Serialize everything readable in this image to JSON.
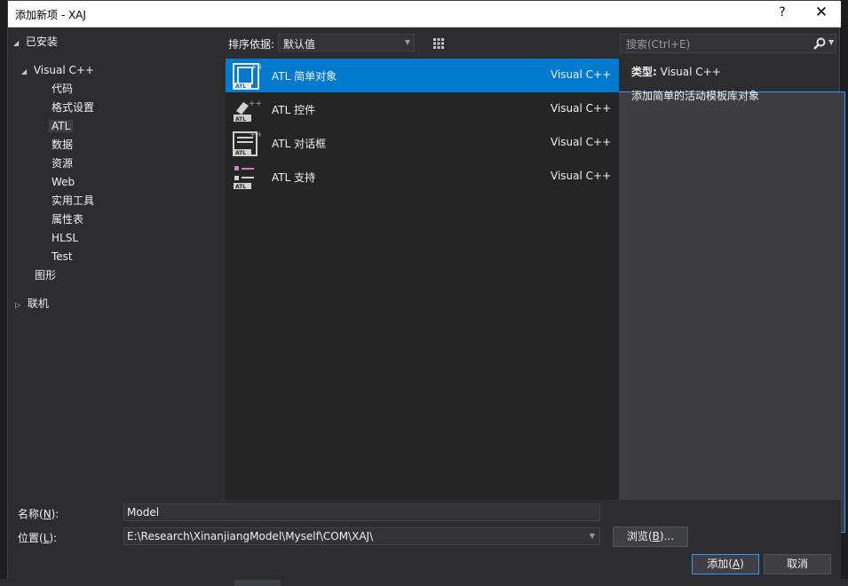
{
  "window": {
    "title": "添加新项 - XAJ",
    "help": "?",
    "close": "✕"
  },
  "tree": {
    "installed": "已安装",
    "visual_cpp": "Visual C++",
    "children": [
      "代码",
      "格式设置",
      "ATL",
      "数据",
      "资源",
      "Web",
      "实用工具",
      "属性表",
      "HLSL",
      "Test"
    ],
    "selected": "ATL",
    "graphics": "图形",
    "online": "联机"
  },
  "sort": {
    "label": "排序依据:",
    "value": "默认值"
  },
  "search": {
    "placeholder": "搜索(Ctrl+E)"
  },
  "templates": [
    {
      "name": "ATL 简单对象",
      "lang": "Visual C++",
      "icon": "atl-simple-object-icon"
    },
    {
      "name": "ATL 控件",
      "lang": "Visual C++",
      "icon": "atl-control-icon"
    },
    {
      "name": "ATL 对话框",
      "lang": "Visual C++",
      "icon": "atl-dialog-icon"
    },
    {
      "name": "ATL 支持",
      "lang": "Visual C++",
      "icon": "atl-support-icon"
    }
  ],
  "info": {
    "type_label": "类型:",
    "type_value": "Visual C++",
    "description": "添加简单的活动模板库对象"
  },
  "form": {
    "name_label": "名称(",
    "name_key": "N",
    "name_suffix": "):",
    "name_value": "Model",
    "location_label": "位置(",
    "location_key": "L",
    "location_suffix": "):",
    "location_value": "E:\\Research\\XinanjiangModel\\Myself\\COM\\XAJ\\",
    "browse_label": "浏览(",
    "browse_key": "B",
    "browse_suffix": ")...",
    "add_label": "添加(",
    "add_key": "A",
    "add_suffix": ")",
    "cancel_label": "取消"
  },
  "colors": {
    "accent": "#007acc",
    "icon_purple": "#c586c0"
  }
}
